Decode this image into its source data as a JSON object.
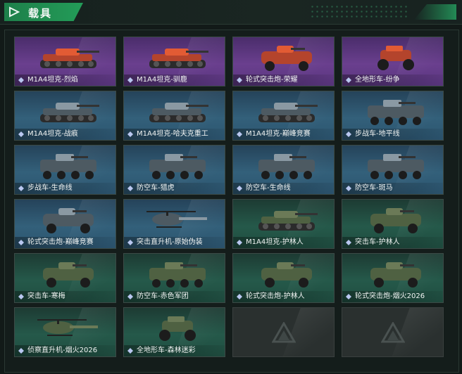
{
  "header": {
    "title": "载具"
  },
  "colors": {
    "accent": "#239c58",
    "purple": "#6a3f8e",
    "blue": "#33607a",
    "green": "#25594a"
  },
  "vehicles": [
    {
      "name": "M1A4坦克-烈焰",
      "tier": "purple",
      "kind": "tank",
      "icon": "diamond-icon"
    },
    {
      "name": "M1A4坦克-驯鹿",
      "tier": "purple",
      "kind": "tank",
      "icon": "diamond-icon"
    },
    {
      "name": "轮式突击炮-荣耀",
      "tier": "purple",
      "kind": "wheeled",
      "icon": "diamond-icon"
    },
    {
      "name": "全地形车-纷争",
      "tier": "purple",
      "kind": "atv",
      "icon": "diamond-icon"
    },
    {
      "name": "M1A4坦克-战痕",
      "tier": "blue",
      "kind": "tank",
      "icon": "diamond-icon"
    },
    {
      "name": "M1A4坦克-哈夫克重工",
      "tier": "blue",
      "kind": "tank",
      "icon": "diamond-icon"
    },
    {
      "name": "M1A4坦克-巅峰竞赛",
      "tier": "blue",
      "kind": "tank",
      "icon": "diamond-icon"
    },
    {
      "name": "步战车-地平线",
      "tier": "blue",
      "kind": "ifv",
      "icon": "diamond-icon"
    },
    {
      "name": "步战车-生命线",
      "tier": "blue",
      "kind": "ifv",
      "icon": "diamond-icon"
    },
    {
      "name": "防空车-猎虎",
      "tier": "blue",
      "kind": "ifv",
      "icon": "diamond-icon"
    },
    {
      "name": "防空车-生命线",
      "tier": "blue",
      "kind": "ifv",
      "icon": "diamond-icon"
    },
    {
      "name": "防空车-斑马",
      "tier": "blue",
      "kind": "ifv",
      "icon": "diamond-icon"
    },
    {
      "name": "轮式突击炮-巅峰竞赛",
      "tier": "blue",
      "kind": "wheeled",
      "icon": "diamond-icon"
    },
    {
      "name": "突击直升机-原始伪装",
      "tier": "blue",
      "kind": "heli",
      "icon": "diamond-icon"
    },
    {
      "name": "M1A4坦克-护林人",
      "tier": "green",
      "kind": "tank",
      "icon": "diamond-icon"
    },
    {
      "name": "突击车-护林人",
      "tier": "green",
      "kind": "wheeled",
      "icon": "diamond-icon"
    },
    {
      "name": "突击车-寒梅",
      "tier": "green",
      "kind": "wheeled",
      "icon": "diamond-icon"
    },
    {
      "name": "防空车-赤色军团",
      "tier": "green",
      "kind": "ifv",
      "icon": "diamond-icon"
    },
    {
      "name": "轮式突击炮-护林人",
      "tier": "green",
      "kind": "wheeled",
      "icon": "diamond-icon"
    },
    {
      "name": "轮式突击炮-烟火2026",
      "tier": "green",
      "kind": "wheeled",
      "icon": "diamond-icon"
    },
    {
      "name": "侦察直升机-烟火2026",
      "tier": "green",
      "kind": "heli",
      "icon": "diamond-icon"
    },
    {
      "name": "全地形车-森林迷彩",
      "tier": "green",
      "kind": "atv",
      "icon": "diamond-icon"
    },
    {
      "name": "",
      "tier": "empty",
      "kind": "empty",
      "icon": "logo-icon"
    },
    {
      "name": "",
      "tier": "empty",
      "kind": "empty",
      "icon": "logo-icon"
    }
  ]
}
